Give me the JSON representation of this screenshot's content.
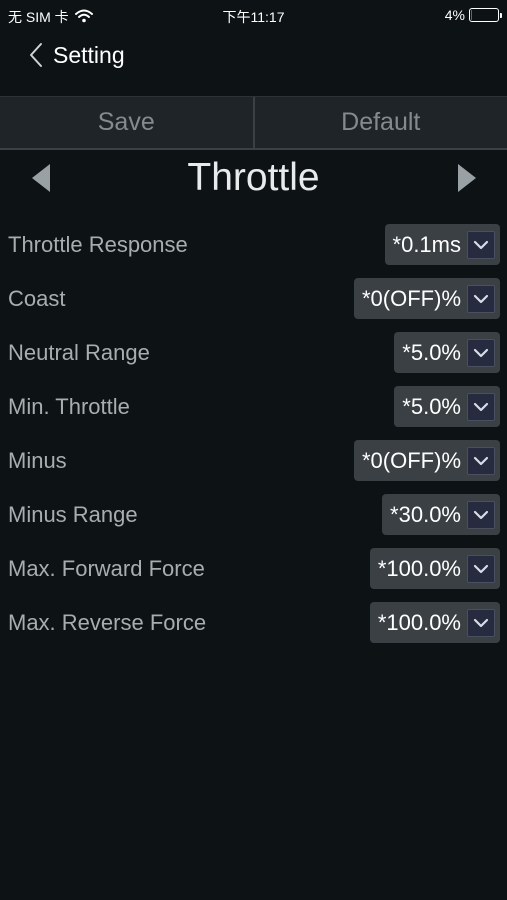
{
  "status_bar": {
    "carrier": "无 SIM 卡",
    "time": "下午11:17",
    "battery_percent": "4%",
    "battery_level": 0.04
  },
  "nav": {
    "title": "Setting"
  },
  "actions": {
    "save_label": "Save",
    "default_label": "Default"
  },
  "section": {
    "title": "Throttle"
  },
  "settings": [
    {
      "label": "Throttle Response",
      "value": "*0.1ms"
    },
    {
      "label": "Coast",
      "value": "*0(OFF)%"
    },
    {
      "label": "Neutral Range",
      "value": "*5.0%"
    },
    {
      "label": "Min. Throttle",
      "value": "*5.0%"
    },
    {
      "label": "Minus",
      "value": "*0(OFF)%"
    },
    {
      "label": "Minus Range",
      "value": "*30.0%"
    },
    {
      "label": "Max. Forward Force",
      "value": "*100.0%"
    },
    {
      "label": "Max. Reverse Force",
      "value": "*100.0%"
    }
  ],
  "icons": {
    "wifi": "wifi-icon",
    "battery": "battery-icon",
    "back": "chevron-left-icon",
    "prev": "triangle-left-icon",
    "next": "triangle-right-icon",
    "dropdown": "chevron-down-icon"
  },
  "colors": {
    "background": "#0d1215",
    "battery_low": "#e0303a",
    "select_bg": "#3b4044"
  }
}
